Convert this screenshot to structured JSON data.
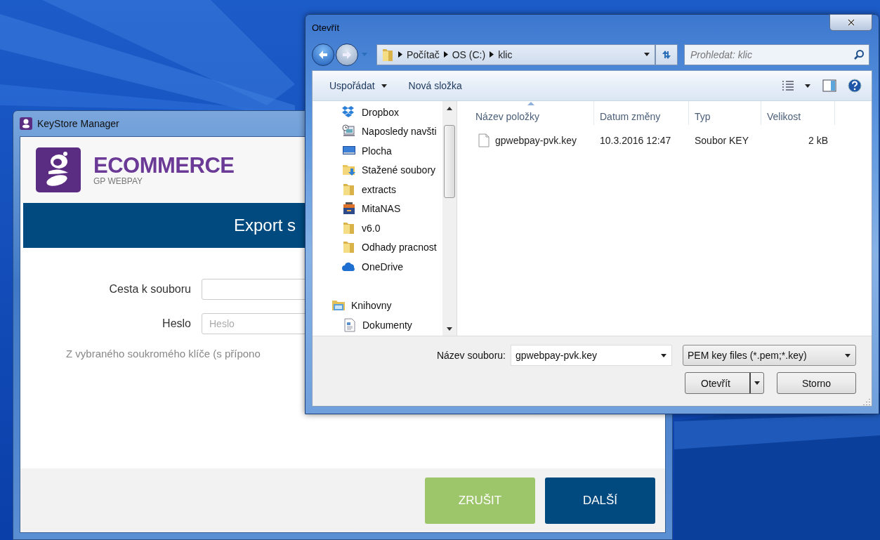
{
  "keystore_window": {
    "title": "KeyStore Manager",
    "brand": {
      "name": "ECOMMERCE",
      "subtitle": "GP WEBPAY"
    },
    "banner": "Export s",
    "fields": [
      {
        "label": "Cesta k souboru"
      },
      {
        "label": "Heslo",
        "placeholder": "Heslo"
      }
    ],
    "description": "Z vybraného soukromého klíče (s přípono",
    "buttons": [
      {
        "label": "ZRUŠIT",
        "kind": "secondary"
      },
      {
        "label": "DALŠÍ",
        "kind": "primary"
      }
    ]
  },
  "open_dialog": {
    "title": "Otevřít",
    "path": [
      "Počítač",
      "OS (C:)",
      "klic"
    ],
    "search": {
      "placeholder": "Prohledat: klic"
    },
    "toolbar": [
      {
        "label": "Uspořádat",
        "dropdown": true
      },
      {
        "label": "Nová složka",
        "dropdown": false
      }
    ],
    "navigation": {
      "favorites": [
        {
          "label": "Dropbox",
          "kind": "dropbox"
        },
        {
          "label": "Naposledy navšti",
          "kind": "recent"
        },
        {
          "label": "Plocha",
          "kind": "desktop"
        },
        {
          "label": "Stažené soubory",
          "kind": "downloads"
        },
        {
          "label": "extracts",
          "kind": "folder"
        },
        {
          "label": "MitaNAS",
          "kind": "nas"
        },
        {
          "label": "v6.0",
          "kind": "folder"
        },
        {
          "label": "Odhady pracnost",
          "kind": "folder"
        },
        {
          "label": "OneDrive",
          "kind": "cloud"
        }
      ],
      "libraries": [
        {
          "label": "Knihovny",
          "kind": "library",
          "children": [
            {
              "label": "Dokumenty",
              "kind": "document"
            }
          ]
        }
      ]
    },
    "columns": [
      {
        "label": "Název položky",
        "sorted": true
      },
      {
        "label": "Datum změny",
        "sorted": false
      },
      {
        "label": "Typ",
        "sorted": false
      },
      {
        "label": "Velikost",
        "sorted": false
      }
    ],
    "files": [
      {
        "name": "gpwebpay-pvk.key",
        "date": "10.3.2016 12:47",
        "type": "Soubor KEY",
        "size": "2 kB"
      }
    ],
    "filename_label": "Název souboru:",
    "filename": "gpwebpay-pvk.key",
    "filetype": "PEM key files (*.pem;*.key)",
    "buttons": [
      {
        "label": "Otevřít",
        "split": true
      },
      {
        "label": "Storno",
        "split": false
      }
    ]
  }
}
